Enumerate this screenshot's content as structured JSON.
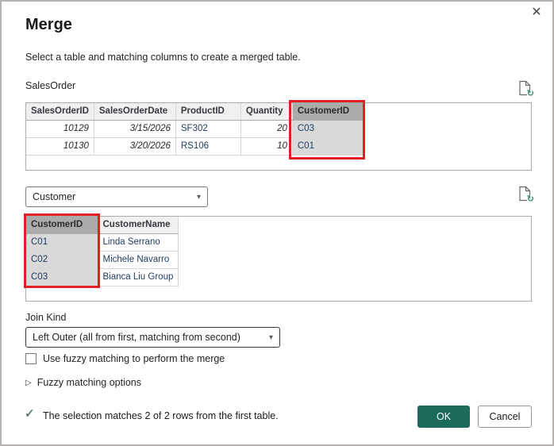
{
  "dialog": {
    "title": "Merge",
    "subtitle": "Select a table and matching columns to create a merged table."
  },
  "icons": {
    "close": "✕",
    "chevron_down": "▾",
    "expander": "▷",
    "check": "✓",
    "refresh": "↻"
  },
  "first_table": {
    "label": "SalesOrder",
    "columns": [
      "SalesOrderID",
      "SalesOrderDate",
      "ProductID",
      "Quantity",
      "CustomerID"
    ],
    "selected_column": "CustomerID",
    "rows": [
      [
        "10129",
        "3/15/2026",
        "SF302",
        "20",
        "C03"
      ],
      [
        "10130",
        "3/20/2026",
        "RS106",
        "10",
        "C01"
      ]
    ]
  },
  "table_picker": {
    "selected": "Customer"
  },
  "second_table": {
    "columns": [
      "CustomerID",
      "CustomerName"
    ],
    "selected_column": "CustomerID",
    "rows": [
      [
        "C01",
        "Linda Serrano"
      ],
      [
        "C02",
        "Michele Navarro"
      ],
      [
        "C03",
        "Bianca Liu Group"
      ]
    ]
  },
  "join_kind": {
    "label": "Join Kind",
    "selected": "Left Outer (all from first, matching from second)"
  },
  "fuzzy": {
    "checkbox_label": "Use fuzzy matching to perform the merge",
    "checked": false,
    "options_label": "Fuzzy matching options"
  },
  "status": {
    "message": "The selection matches 2 of 2 rows from the first table."
  },
  "actions": {
    "ok": "OK",
    "cancel": "Cancel"
  },
  "colors": {
    "ok_button": "#1a6b5a",
    "highlight_red": "#e31e24",
    "selected_header_bg": "#ababab",
    "selected_cell_bg": "#d9d9d9",
    "header_bg": "#f0f0f0",
    "refresh_green": "#3e8e78"
  }
}
